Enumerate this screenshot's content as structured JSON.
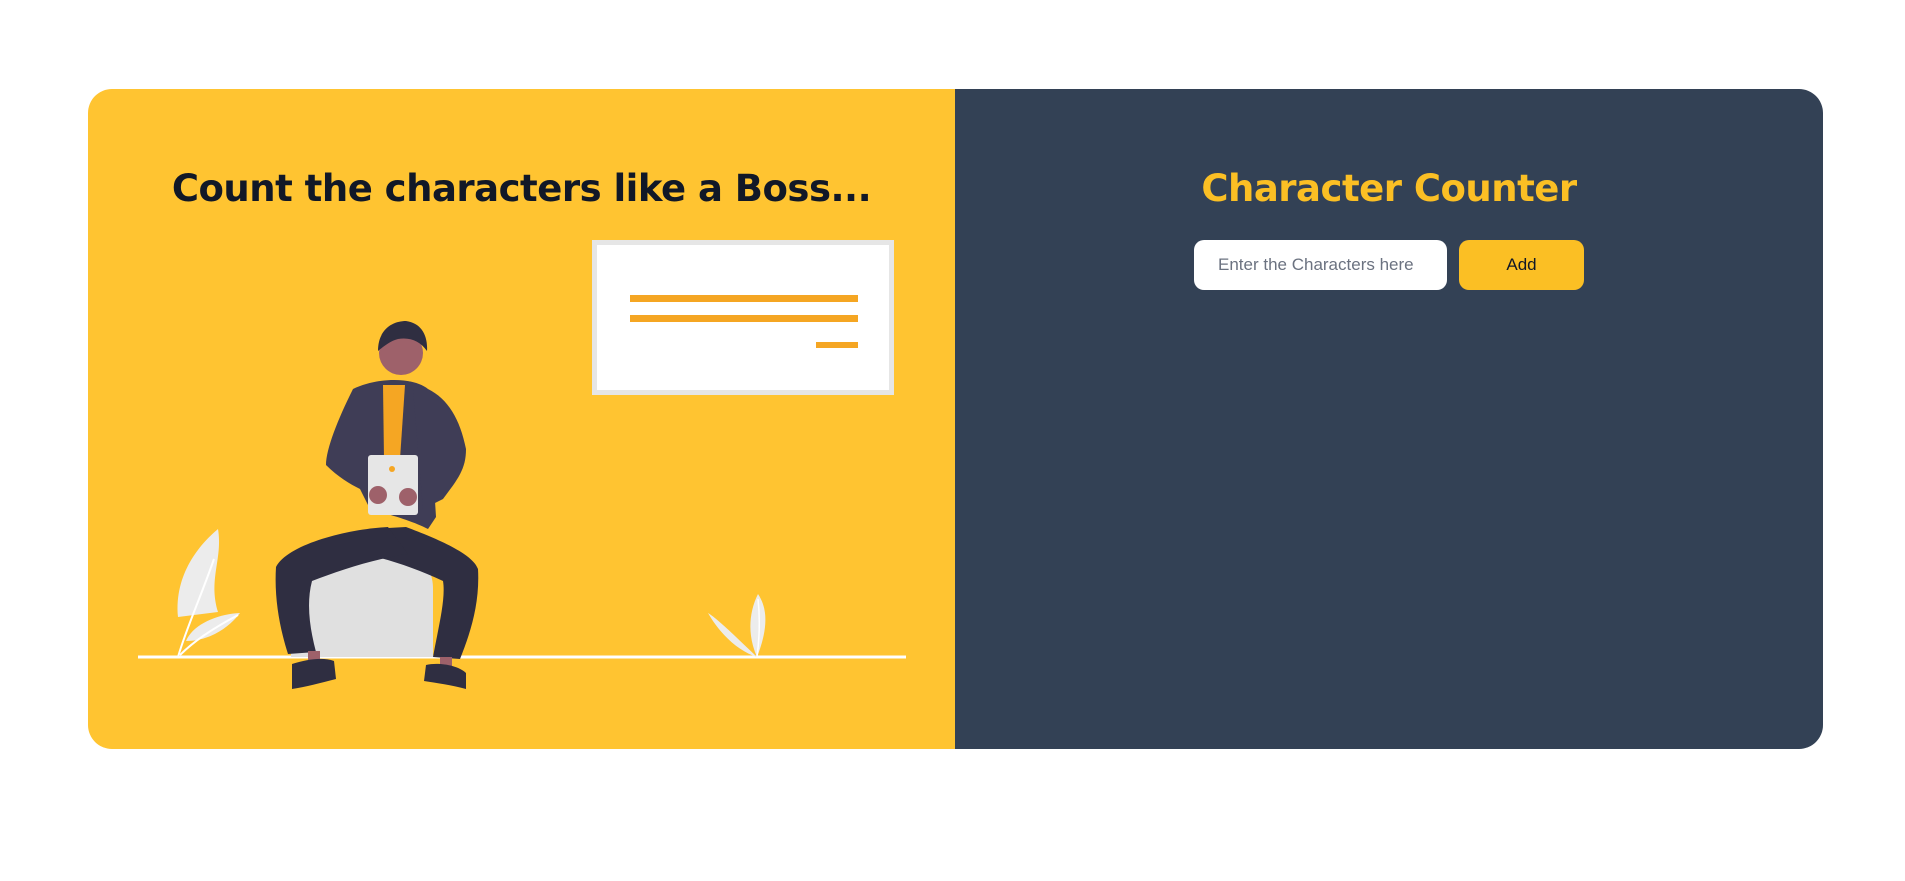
{
  "hero": {
    "title": "Count the characters like a Boss..."
  },
  "counter": {
    "title": "Character Counter",
    "input_placeholder": "Enter the Characters here",
    "input_value": "",
    "add_label": "Add"
  },
  "colors": {
    "left_background": "#ffc431",
    "right_background": "#334155",
    "accent": "#fbbf24",
    "heading_dark": "#111827"
  },
  "illustration": {
    "name": "person-with-tablet-illustration"
  }
}
